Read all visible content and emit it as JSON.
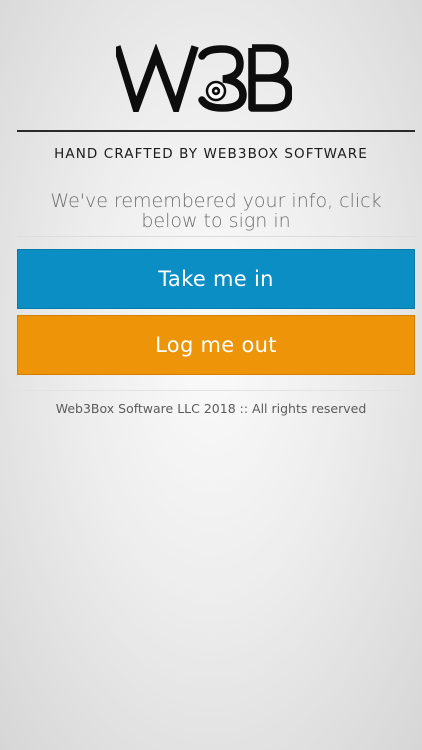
{
  "header": {
    "logo_text": "W3B",
    "tagline": "HAND CRAFTED BY WEB3BOX SOFTWARE"
  },
  "main": {
    "message": "We've remembered your info, click below to sign in",
    "primary_button": {
      "label": "Take me in",
      "color": "#0a8ec4"
    },
    "secondary_button": {
      "label": "Log me out",
      "color": "#ed9408"
    }
  },
  "footer": {
    "copyright": "Web3Box Software LLC 2018 :: All rights reserved"
  }
}
